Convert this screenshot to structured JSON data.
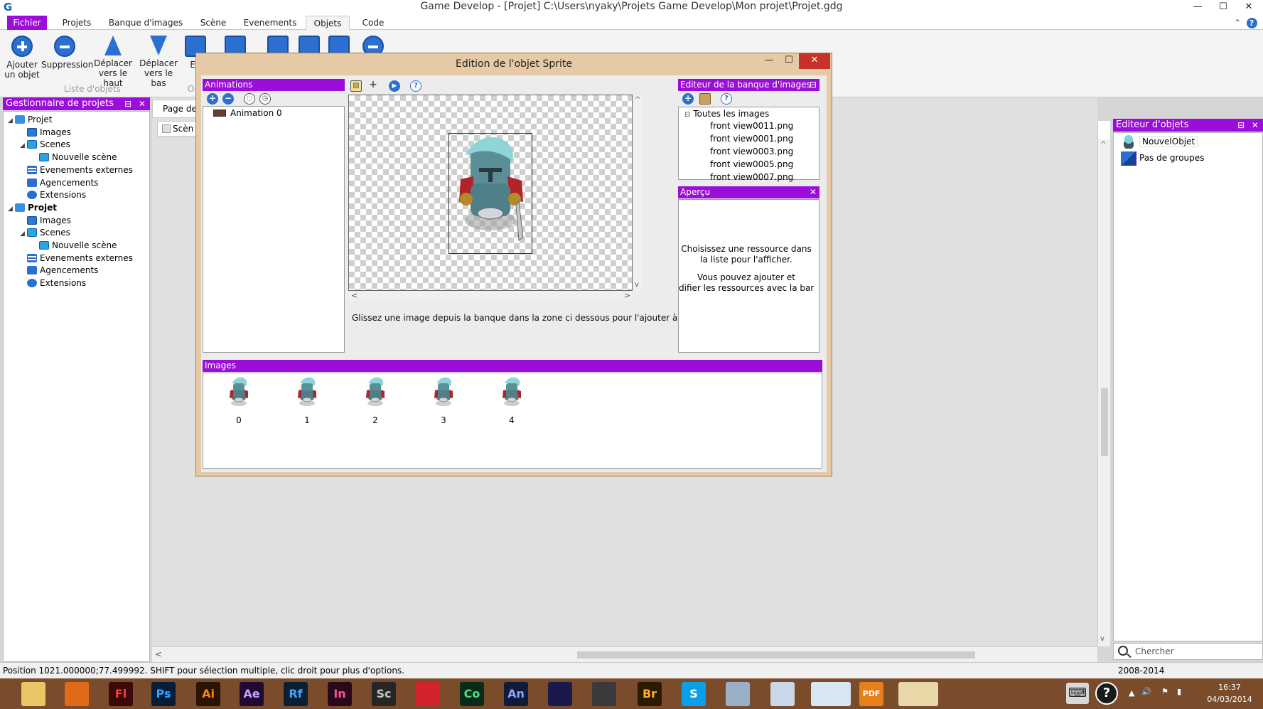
{
  "window": {
    "title": "Game Develop - [Projet] C:\\Users\\nyaky\\Projets Game Develop\\Mon projet\\Projet.gdg",
    "min": "—",
    "max": "☐",
    "close": "✕"
  },
  "menu": {
    "tabs": [
      "Fichier",
      "Projets",
      "Banque d'images",
      "Scène",
      "Evenements",
      "Objets",
      "Code"
    ],
    "active": "Objets",
    "collapse": "⌃",
    "help": "?"
  },
  "ribbon": {
    "add_line1": "Ajouter",
    "add_line2": "un objet",
    "delete": "Suppression",
    "up_line1": "Déplacer",
    "up_line2": "vers le haut",
    "down_line1": "Déplacer",
    "down_line2": "vers le bas",
    "edit_partial": "Ed",
    "group_label": "Liste d'objets",
    "cut_letter": "O"
  },
  "left_panel": {
    "title": "Gestionnaire de projets",
    "buttons": "⊟ ✕",
    "tree": [
      {
        "label": "Projet",
        "level": 0,
        "icon": "projet",
        "toggle": "◢",
        "bold": false
      },
      {
        "label": "Images",
        "level": 1,
        "icon": "images",
        "toggle": "",
        "bold": false
      },
      {
        "label": "Scenes",
        "level": 1,
        "icon": "scenes",
        "toggle": "◢",
        "bold": false
      },
      {
        "label": "Nouvelle scène",
        "level": 2,
        "icon": "scene",
        "toggle": "",
        "bold": false
      },
      {
        "label": "Evenements externes",
        "level": 1,
        "icon": "events",
        "toggle": "",
        "bold": false
      },
      {
        "label": "Agencements",
        "level": 1,
        "icon": "layouts",
        "toggle": "",
        "bold": false
      },
      {
        "label": "Extensions",
        "level": 1,
        "icon": "ext",
        "toggle": "",
        "bold": false
      },
      {
        "label": "Projet",
        "level": 0,
        "icon": "projet",
        "toggle": "◢",
        "bold": true
      },
      {
        "label": "Images",
        "level": 1,
        "icon": "images",
        "toggle": "",
        "bold": false
      },
      {
        "label": "Scenes",
        "level": 1,
        "icon": "scenes",
        "toggle": "◢",
        "bold": false
      },
      {
        "label": "Nouvelle scène",
        "level": 2,
        "icon": "scene",
        "toggle": "",
        "bold": false
      },
      {
        "label": "Evenements externes",
        "level": 1,
        "icon": "events",
        "toggle": "",
        "bold": false
      },
      {
        "label": "Agencements",
        "level": 1,
        "icon": "layouts",
        "toggle": "",
        "bold": false
      },
      {
        "label": "Extensions",
        "level": 1,
        "icon": "ext",
        "toggle": "",
        "bold": false
      }
    ]
  },
  "center": {
    "page_tab": "Page de",
    "scene_tab": "Scèn",
    "scroll_left": "<",
    "scroll_up": "^",
    "scroll_down": "v"
  },
  "right_panel": {
    "title": "Editeur d'objets",
    "buttons": "⊟ ✕",
    "items": [
      "NouvelObjet",
      "Pas de groupes"
    ],
    "search_placeholder": "Chercher"
  },
  "status": {
    "position": "Position 1021.000000;77.499992. SHIFT pour sélection multiple, clic droit pour plus d'options.",
    "years": "2008-2014"
  },
  "dialog": {
    "title": "Edition de l'objet Sprite",
    "min": "—",
    "max": "☐",
    "close": "✕",
    "animations_title": "Animations",
    "animations": [
      "Animation 0"
    ],
    "anim_tools": {
      "add": "+",
      "remove": "−"
    },
    "canvas_hint": "Glissez une image depuis la banque dans la zone ci dessous pour l'ajouter à l'animation.",
    "canvas_tools": {
      "add": "+"
    },
    "canvas_scroll": {
      "left": "<",
      "right": ">",
      "up": "^",
      "down": "v"
    },
    "bank_title": "Editeur de la banque d'images",
    "bank_root": "Toutes les images",
    "bank_toggle": "⊟",
    "bank_images": [
      "front view0011.png",
      "front view0001.png",
      "front view0003.png",
      "front view0005.png",
      "front view0007.png"
    ],
    "preview_title": "Aperçu",
    "preview_close": "✕",
    "preview_line1": "Choisissez une ressource dans",
    "preview_line2": "la liste pour l'afficher.",
    "preview_line3": "Vous pouvez ajouter et",
    "preview_line4": "difier les ressources avec la barre d'o",
    "images_title": "Images",
    "frames": [
      "0",
      "1",
      "2",
      "3",
      "4"
    ]
  },
  "taskbar": {
    "apps": [
      {
        "name": "file-explorer-icon",
        "label": "",
        "bg": "#e9c766",
        "fg": "#5a3a10"
      },
      {
        "name": "firefox-icon",
        "label": "",
        "bg": "#e06a1a",
        "fg": "#fff"
      },
      {
        "name": "flash-icon",
        "label": "Fl",
        "bg": "#3a0a0a",
        "fg": "#ff3b2f"
      },
      {
        "name": "photoshop-icon",
        "label": "Ps",
        "bg": "#061e3a",
        "fg": "#2fa3ff"
      },
      {
        "name": "illustrator-icon",
        "label": "Ai",
        "bg": "#2a1300",
        "fg": "#ff8a00"
      },
      {
        "name": "after-effects-icon",
        "label": "Ae",
        "bg": "#1f0a33",
        "fg": "#c9a0ff"
      },
      {
        "name": "reflow-icon",
        "label": "Rf",
        "bg": "#0a1f33",
        "fg": "#3aa7ff"
      },
      {
        "name": "indesign-icon",
        "label": "In",
        "bg": "#2a0a1a",
        "fg": "#ff4fa0"
      },
      {
        "name": "scout-icon",
        "label": "Sc",
        "bg": "#262626",
        "fg": "#c5c5c5"
      },
      {
        "name": "creative-cloud-icon",
        "label": "",
        "bg": "#d4242b",
        "fg": "#fff"
      },
      {
        "name": "coda-icon",
        "label": "Co",
        "bg": "#0a2a1a",
        "fg": "#4fe08a"
      },
      {
        "name": "animate-icon",
        "label": "An",
        "bg": "#101a3a",
        "fg": "#8aa8ff"
      },
      {
        "name": "media-icon",
        "label": "",
        "bg": "#1a1a4a",
        "fg": "#fff"
      },
      {
        "name": "unity-icon",
        "label": "",
        "bg": "#3a3a3a",
        "fg": "#fff"
      },
      {
        "name": "bridge-icon",
        "label": "Br",
        "bg": "#2a1a00",
        "fg": "#ffb02f"
      },
      {
        "name": "skype-icon",
        "label": "S",
        "bg": "#0aa0e8",
        "fg": "#fff"
      },
      {
        "name": "monitor-icon",
        "label": "",
        "bg": "#9ab0c8",
        "fg": "#fff"
      },
      {
        "name": "network-icon",
        "label": "",
        "bg": "#c8d8e8",
        "fg": "#333"
      },
      {
        "name": "game-develop-icon",
        "label": "",
        "bg": "#d8e6f2",
        "fg": "#1a5fb4"
      },
      {
        "name": "pdf-icon",
        "label": "PDF",
        "bg": "#e8801a",
        "fg": "#fff"
      },
      {
        "name": "paint-icon",
        "label": "",
        "bg": "#e8d8a8",
        "fg": "#333"
      }
    ],
    "tray": {
      "keyboard": "⌨",
      "help": "?",
      "arrow": "▲",
      "volume": "🔊",
      "flag": "⚑",
      "signal": "▮"
    },
    "time": "16:37",
    "date": "04/03/2014"
  },
  "colors": {
    "accent": "#9b0dd8",
    "dialog_frame": "#e6c9a5",
    "taskbar": "#7a4c2c",
    "close_red": "#c7312a",
    "icon_blue": "#2b6fd1"
  }
}
